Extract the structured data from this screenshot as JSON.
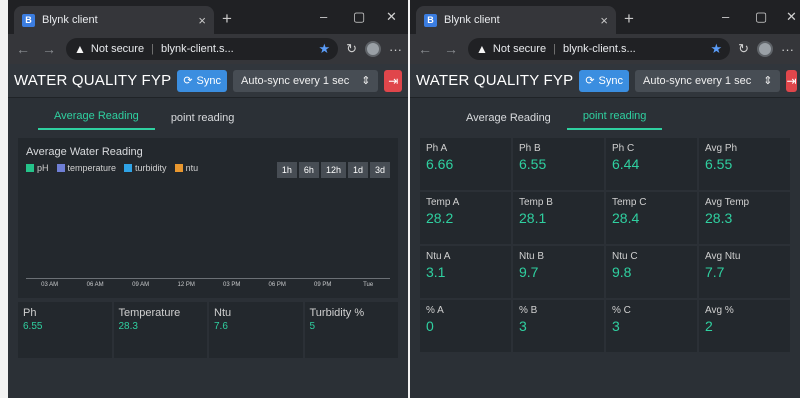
{
  "browser": {
    "tab_title": "Blynk client",
    "favicon_letter": "B",
    "close_glyph": "×",
    "newtab_glyph": "+",
    "minimize_glyph": "–",
    "maximize_glyph": "▢",
    "window_close_glyph": "✕",
    "security_label": "Not secure",
    "url": "blynk-client.s...",
    "url_right": "blynk-client.s...",
    "more_glyph": "···"
  },
  "app": {
    "title": "WATER QUALITY FYP",
    "sync_label": "Sync",
    "autosync_label": "Auto-sync every 1 sec",
    "autosync_label_right": "Auto-sync every 1 sec"
  },
  "tabs": {
    "average": "Average Reading",
    "point": "point reading"
  },
  "chart": {
    "title": "Average Water Reading",
    "ranges": [
      "1h",
      "6h",
      "12h",
      "1d",
      "3d"
    ]
  },
  "chart_data": {
    "type": "line",
    "title": "Average Water Reading",
    "series": [
      {
        "name": "pH",
        "color": "#25c38a",
        "values": []
      },
      {
        "name": "temperature",
        "color": "#6f7fd6",
        "values": []
      },
      {
        "name": "turbidity",
        "color": "#2fa3e6",
        "values": []
      },
      {
        "name": "ntu",
        "color": "#e8972f",
        "values": []
      }
    ],
    "x_ticks": [
      "03 AM",
      "06 AM",
      "09 AM",
      "12 PM",
      "03 PM",
      "06 PM",
      "09 PM",
      "Tue"
    ]
  },
  "avg_cards": [
    {
      "label": "Ph",
      "value": "6.55"
    },
    {
      "label": "Temperature",
      "value": "28.3"
    },
    {
      "label": "Ntu",
      "value": "7.6"
    },
    {
      "label": "Turbidity %",
      "value": "5"
    }
  ],
  "point_cards": [
    {
      "label": "Ph A",
      "value": "6.66"
    },
    {
      "label": "Ph B",
      "value": "6.55"
    },
    {
      "label": "Ph C",
      "value": "6.44"
    },
    {
      "label": "Avg Ph",
      "value": "6.55"
    },
    {
      "label": "Temp A",
      "value": "28.2"
    },
    {
      "label": "Temp B",
      "value": "28.1"
    },
    {
      "label": "Temp C",
      "value": "28.4"
    },
    {
      "label": "Avg Temp",
      "value": "28.3"
    },
    {
      "label": "Ntu A",
      "value": "3.1"
    },
    {
      "label": "Ntu B",
      "value": "9.7"
    },
    {
      "label": "Ntu C",
      "value": "9.8"
    },
    {
      "label": "Avg Ntu",
      "value": "7.7"
    },
    {
      "label": "% A",
      "value": "0"
    },
    {
      "label": "% B",
      "value": "3"
    },
    {
      "label": "% C",
      "value": "3"
    },
    {
      "label": "Avg %",
      "value": "2"
    }
  ]
}
